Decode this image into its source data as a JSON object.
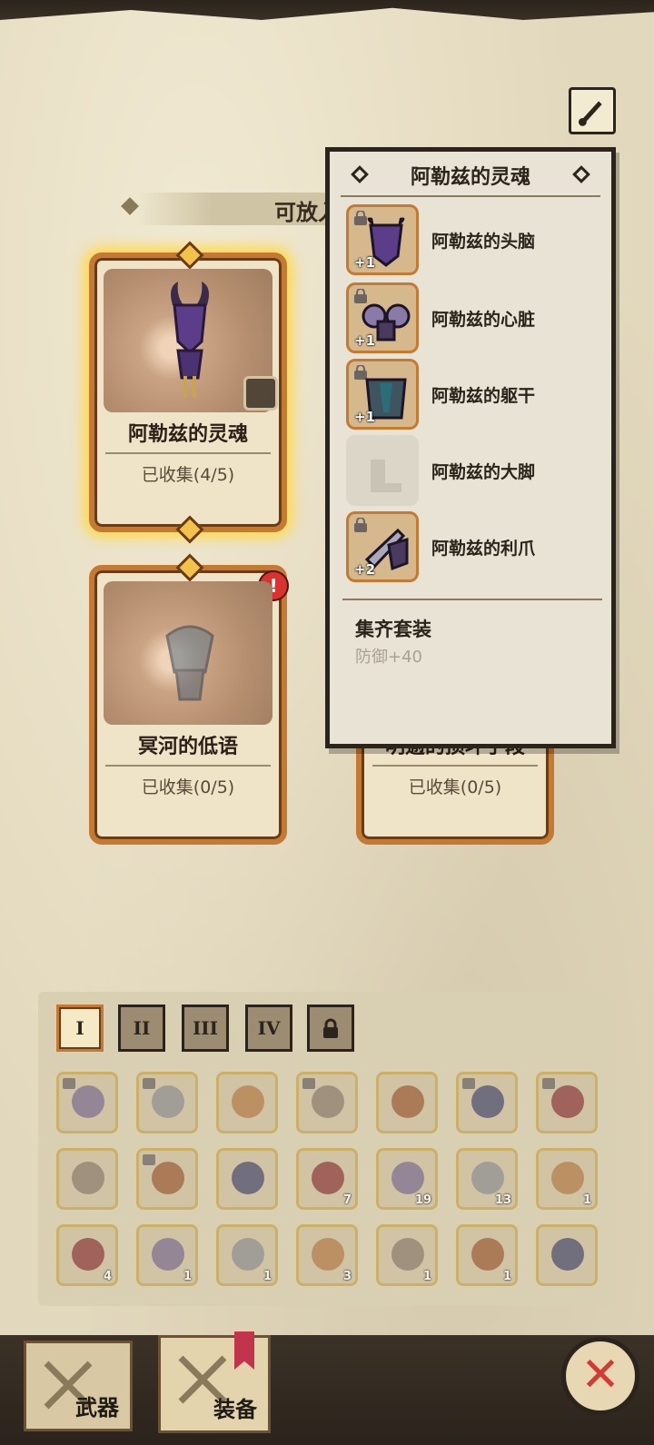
{
  "header": {
    "section_title": "可放入套"
  },
  "set_cards": [
    {
      "name": "阿勒兹的灵魂",
      "collected": "已收集(4/5)",
      "selected": true,
      "alert": false
    },
    {
      "name": "冥河的低语",
      "collected": "已收集(0/5)",
      "selected": false,
      "alert": true,
      "alert_symbol": "!"
    },
    {
      "name": "明逾的损坏手段",
      "collected": "已收集(0/5)",
      "selected": false,
      "alert": false
    }
  ],
  "popup": {
    "title": "阿勒兹的灵魂",
    "parts": [
      {
        "label": "阿勒兹的头脑",
        "bonus": "+1",
        "locked": true,
        "owned": true,
        "icon": "helmet-icon"
      },
      {
        "label": "阿勒兹的心脏",
        "bonus": "+1",
        "locked": true,
        "owned": true,
        "icon": "shoulder-icon"
      },
      {
        "label": "阿勒兹的躯干",
        "bonus": "+1",
        "locked": true,
        "owned": true,
        "icon": "armor-icon"
      },
      {
        "label": "阿勒兹的大脚",
        "bonus": "",
        "locked": false,
        "owned": false,
        "icon": "boots-icon"
      },
      {
        "label": "阿勒兹的利爪",
        "bonus": "+2",
        "locked": true,
        "owned": true,
        "icon": "claw-icon"
      }
    ],
    "set_title": "集齐套装",
    "set_bonus": "防御+40"
  },
  "inventory": {
    "tabs": [
      {
        "label": "I",
        "active": true
      },
      {
        "label": "II",
        "active": false
      },
      {
        "label": "III",
        "active": false
      },
      {
        "label": "IV",
        "active": false
      },
      {
        "label": "",
        "locked": true
      }
    ],
    "rows": [
      [
        {
          "icon": "helmet-icon",
          "count": "",
          "locked": true
        },
        {
          "icon": "knight-helm-icon",
          "count": "",
          "locked": true
        },
        {
          "icon": "spartan-helm-icon",
          "count": "",
          "locked": false
        },
        {
          "icon": "chest-armor-icon",
          "count": "",
          "locked": true
        },
        {
          "icon": "cloak-icon",
          "count": "",
          "locked": false
        },
        {
          "icon": "dark-armor-icon",
          "count": "",
          "locked": true
        },
        {
          "icon": "boots-icon",
          "count": "",
          "locked": true
        }
      ],
      [
        {
          "icon": "beast-icon",
          "count": "",
          "locked": false
        },
        {
          "icon": "bone-icon",
          "count": "",
          "locked": true
        },
        {
          "icon": "claw-icon",
          "count": "",
          "locked": false
        },
        {
          "icon": "scroll-eye-icon",
          "count": "7",
          "locked": false
        },
        {
          "icon": "red-potion-icon",
          "count": "19",
          "locked": false
        },
        {
          "icon": "green-potion-icon",
          "count": "13",
          "locked": false
        },
        {
          "icon": "pink-potion-icon",
          "count": "1",
          "locked": false
        }
      ],
      [
        {
          "icon": "star-potion-icon",
          "count": "4",
          "locked": false
        },
        {
          "icon": "heart-icon",
          "count": "1",
          "locked": false
        },
        {
          "icon": "orb-icon",
          "count": "1",
          "locked": false
        },
        {
          "icon": "glove-icon",
          "count": "3",
          "locked": false
        },
        {
          "icon": "ruby-icon",
          "count": "1",
          "locked": false
        },
        {
          "icon": "crystal-icon",
          "count": "1",
          "locked": false
        },
        {
          "icon": "book-icon",
          "count": "",
          "locked": false
        }
      ]
    ]
  },
  "nav": {
    "weapons_label": "武器",
    "equipment_label": "装备",
    "close_symbol": "✕"
  },
  "colors": {
    "accent_orange": "#c47a33",
    "selected_glow": "#ffd94d",
    "alert_red": "#d9332f",
    "close_red": "#d23a35"
  }
}
